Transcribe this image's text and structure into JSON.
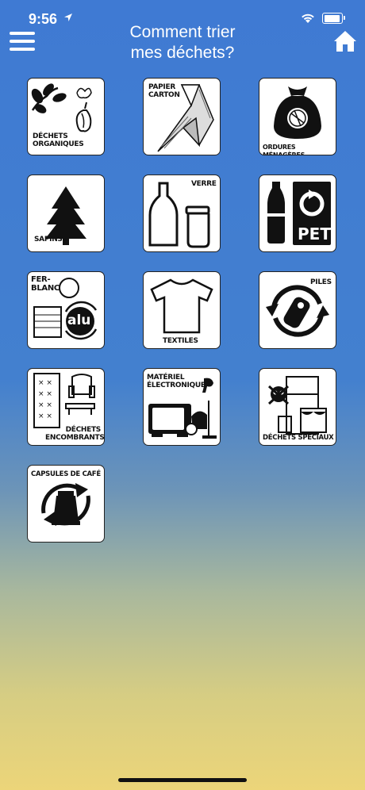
{
  "status_bar": {
    "time": "9:56"
  },
  "header": {
    "title_line1": "Comment trier",
    "title_line2": "mes déchets?"
  },
  "categories": [
    {
      "label": "DÉCHETS\nORGANIQUES",
      "icon": "organic-waste-icon"
    },
    {
      "label": "PAPIER\nCARTON",
      "icon": "paper-cardboard-icon"
    },
    {
      "label": "ORDURES MÉNAGÈRES",
      "icon": "household-waste-bag-icon"
    },
    {
      "label": "SAPINS",
      "icon": "fir-tree-icon"
    },
    {
      "label": "VERRE",
      "icon": "glass-bottles-icon"
    },
    {
      "label": "PET",
      "icon": "pet-bottle-icon"
    },
    {
      "label": "FER-\nBLANC",
      "label2": "alu",
      "icon": "tin-alu-can-icon"
    },
    {
      "label": "TEXTILES",
      "icon": "tshirt-icon"
    },
    {
      "label": "PILES",
      "icon": "battery-recycle-icon"
    },
    {
      "label": "DÉCHETS\nENCOMBRANTS",
      "icon": "bulky-furniture-icon"
    },
    {
      "label": "MATÉRIEL\nÉLECTRONIQUE",
      "icon": "electronics-tv-icon"
    },
    {
      "label": "DÉCHETS SPÉCIAUX",
      "icon": "hazardous-waste-icon"
    },
    {
      "label": "CAPSULES DE CAFÉ",
      "icon": "coffee-capsule-icon"
    }
  ]
}
